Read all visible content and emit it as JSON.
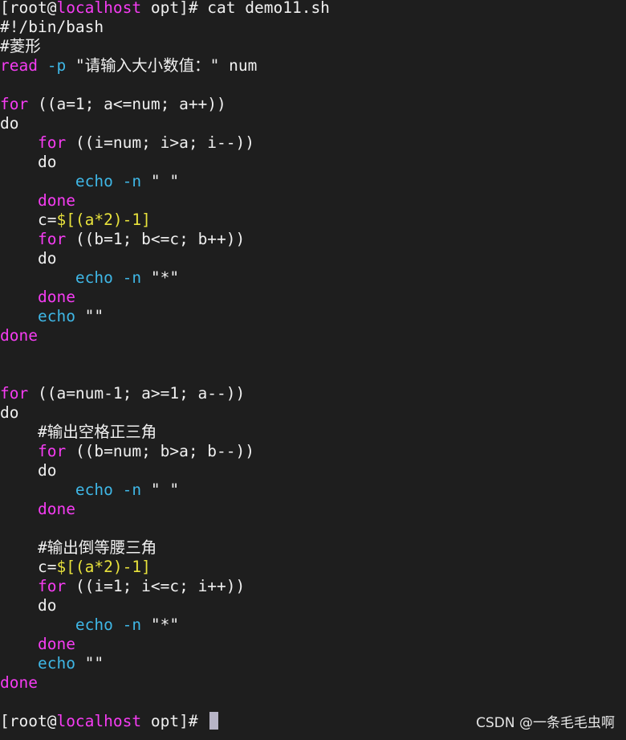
{
  "terminal": {
    "lines": [
      {
        "segments": [
          {
            "text": "[root@",
            "color": "white"
          },
          {
            "text": "localhost",
            "color": "magenta"
          },
          {
            "text": " opt]# cat demo11.sh",
            "color": "white"
          }
        ]
      },
      {
        "segments": [
          {
            "text": "#!/bin/bash",
            "color": "white"
          }
        ]
      },
      {
        "segments": [
          {
            "text": "#菱形",
            "color": "white"
          }
        ]
      },
      {
        "segments": [
          {
            "text": "read",
            "color": "magenta"
          },
          {
            "text": " ",
            "color": "white"
          },
          {
            "text": "-p",
            "color": "cyan"
          },
          {
            "text": " \"请输入大小数值：\" num",
            "color": "white"
          }
        ]
      },
      {
        "segments": []
      },
      {
        "segments": [
          {
            "text": "for",
            "color": "magenta"
          },
          {
            "text": " ((a=1; a<=num; a++))",
            "color": "white"
          }
        ]
      },
      {
        "segments": [
          {
            "text": "do",
            "color": "white"
          }
        ]
      },
      {
        "segments": [
          {
            "text": "    ",
            "color": "white"
          },
          {
            "text": "for",
            "color": "magenta"
          },
          {
            "text": " ((i=num; i>a; i--))",
            "color": "white"
          }
        ]
      },
      {
        "segments": [
          {
            "text": "    do",
            "color": "white"
          }
        ]
      },
      {
        "segments": [
          {
            "text": "        ",
            "color": "white"
          },
          {
            "text": "echo -n",
            "color": "cyan"
          },
          {
            "text": " \" \"",
            "color": "white"
          }
        ]
      },
      {
        "segments": [
          {
            "text": "    ",
            "color": "white"
          },
          {
            "text": "done",
            "color": "magenta"
          }
        ]
      },
      {
        "segments": [
          {
            "text": "    c=",
            "color": "white"
          },
          {
            "text": "$[(a*2)-1]",
            "color": "yellow"
          }
        ]
      },
      {
        "segments": [
          {
            "text": "    ",
            "color": "white"
          },
          {
            "text": "for",
            "color": "magenta"
          },
          {
            "text": " ((b=1; b<=c; b++))",
            "color": "white"
          }
        ]
      },
      {
        "segments": [
          {
            "text": "    do",
            "color": "white"
          }
        ]
      },
      {
        "segments": [
          {
            "text": "        ",
            "color": "white"
          },
          {
            "text": "echo -n",
            "color": "cyan"
          },
          {
            "text": " \"*\"",
            "color": "white"
          }
        ]
      },
      {
        "segments": [
          {
            "text": "    ",
            "color": "white"
          },
          {
            "text": "done",
            "color": "magenta"
          }
        ]
      },
      {
        "segments": [
          {
            "text": "    ",
            "color": "white"
          },
          {
            "text": "echo",
            "color": "cyan"
          },
          {
            "text": " \"\"",
            "color": "white"
          }
        ]
      },
      {
        "segments": [
          {
            "text": "done",
            "color": "magenta"
          }
        ]
      },
      {
        "segments": []
      },
      {
        "segments": []
      },
      {
        "segments": [
          {
            "text": "for",
            "color": "magenta"
          },
          {
            "text": " ((a=num-1; a>=1; a--))",
            "color": "white"
          }
        ]
      },
      {
        "segments": [
          {
            "text": "do",
            "color": "white"
          }
        ]
      },
      {
        "segments": [
          {
            "text": "    #输出空格正三角",
            "color": "white"
          }
        ]
      },
      {
        "segments": [
          {
            "text": "    ",
            "color": "white"
          },
          {
            "text": "for",
            "color": "magenta"
          },
          {
            "text": " ((b=num; b>a; b--))",
            "color": "white"
          }
        ]
      },
      {
        "segments": [
          {
            "text": "    do",
            "color": "white"
          }
        ]
      },
      {
        "segments": [
          {
            "text": "        ",
            "color": "white"
          },
          {
            "text": "echo -n",
            "color": "cyan"
          },
          {
            "text": " \" \"",
            "color": "white"
          }
        ]
      },
      {
        "segments": [
          {
            "text": "    ",
            "color": "white"
          },
          {
            "text": "done",
            "color": "magenta"
          }
        ]
      },
      {
        "segments": []
      },
      {
        "segments": [
          {
            "text": "    #输出倒等腰三角",
            "color": "white"
          }
        ]
      },
      {
        "segments": [
          {
            "text": "    c=",
            "color": "white"
          },
          {
            "text": "$[(a*2)-1]",
            "color": "yellow"
          }
        ]
      },
      {
        "segments": [
          {
            "text": "    ",
            "color": "white"
          },
          {
            "text": "for",
            "color": "magenta"
          },
          {
            "text": " ((i=1; i<=c; i++))",
            "color": "white"
          }
        ]
      },
      {
        "segments": [
          {
            "text": "    do",
            "color": "white"
          }
        ]
      },
      {
        "segments": [
          {
            "text": "        ",
            "color": "white"
          },
          {
            "text": "echo -n",
            "color": "cyan"
          },
          {
            "text": " \"*\"",
            "color": "white"
          }
        ]
      },
      {
        "segments": [
          {
            "text": "    ",
            "color": "white"
          },
          {
            "text": "done",
            "color": "magenta"
          }
        ]
      },
      {
        "segments": [
          {
            "text": "    ",
            "color": "white"
          },
          {
            "text": "echo",
            "color": "cyan"
          },
          {
            "text": " \"\"",
            "color": "white"
          }
        ]
      },
      {
        "segments": [
          {
            "text": "done",
            "color": "magenta"
          }
        ]
      },
      {
        "segments": []
      },
      {
        "segments": [
          {
            "text": "[root@",
            "color": "white"
          },
          {
            "text": "localhost",
            "color": "magenta"
          },
          {
            "text": " opt]# ",
            "color": "white"
          }
        ],
        "cursor": true
      }
    ]
  },
  "watermark": "CSDN @一条毛毛虫啊",
  "colors": {
    "background": "#1e1e1e",
    "white": "#f0f0f0",
    "magenta": "#f53cf2",
    "cyan": "#3fb7e6",
    "yellow": "#e8e23c",
    "cursor": "#b7b4c6"
  }
}
